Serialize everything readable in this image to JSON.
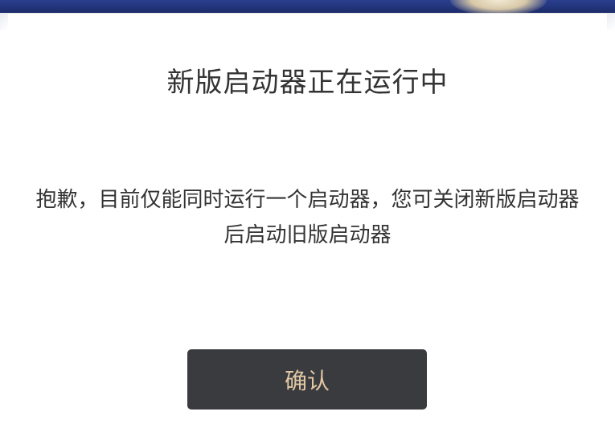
{
  "dialog": {
    "title": "新版启动器正在运行中",
    "message": "抱歉，目前仅能同时运行一个启动器，您可关闭新版启动器后启动旧版启动器",
    "confirm_label": "确认"
  },
  "colors": {
    "background_band": "#1f2f6e",
    "dialog_bg": "#ffffff",
    "text": "#333333",
    "button_bg": "#3a3b3f",
    "button_text": "#e2c8a4"
  }
}
